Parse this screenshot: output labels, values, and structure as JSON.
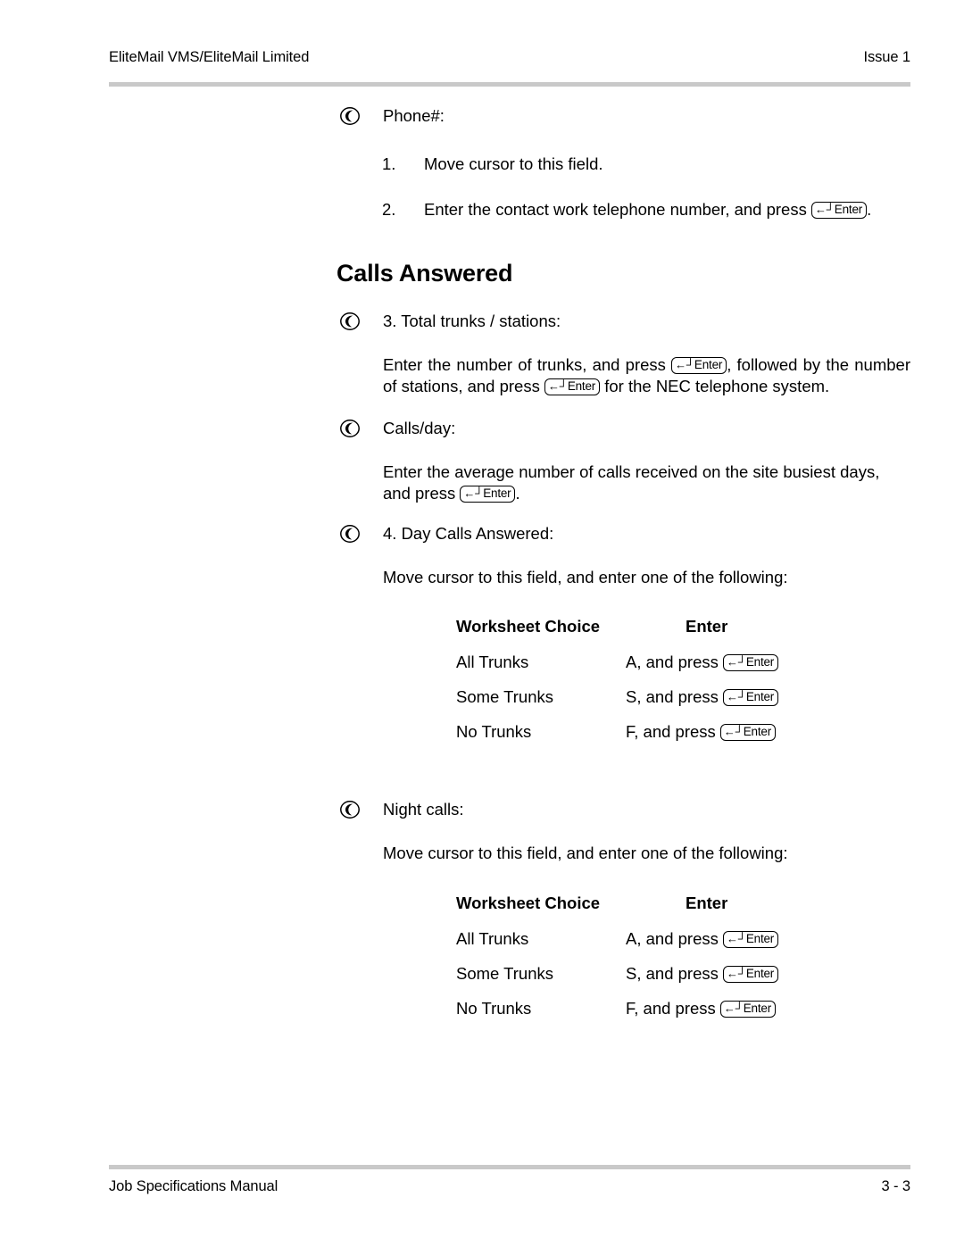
{
  "header": {
    "left": "EliteMail VMS/EliteMail Limited",
    "right": "Issue 1"
  },
  "footer": {
    "left": "Job Specifications Manual",
    "right": "3 - 3"
  },
  "keycap": {
    "arrow": "←┘",
    "label": "Enter",
    "name": "enter-key"
  },
  "bullet_icon": "telephone-bullet-icon",
  "section": {
    "phone": {
      "label": "Phone#:",
      "steps": [
        {
          "num": "1.",
          "text": "Move cursor to this field."
        },
        {
          "num": "2.",
          "text_before": "Enter the contact work telephone number, and press",
          "text_after": "."
        }
      ]
    },
    "heading": "Calls Answered",
    "total_trunks": {
      "label": "3. Total trunks / stations:",
      "body_part1": "Enter the number of trunks, and press",
      "body_part2": ", followed by the number of stations, and press",
      "body_part3": "for the NEC telephone system."
    },
    "calls_per_day": {
      "label": "Calls/day:",
      "body_part1": "Enter the average number of calls received on the site busiest days, and press",
      "body_part2": "."
    },
    "day_calls_answered": {
      "label": "4. Day Calls Answered:",
      "instruction": "Move cursor to this field, and enter one of the following:"
    },
    "night_calls": {
      "label": "Night calls:",
      "instruction": "Move cursor to this field, and enter one of the following:"
    }
  },
  "tables": [
    {
      "name": "day-calls-answered-choice-table",
      "headers": [
        "Worksheet Choice",
        "Enter"
      ],
      "rows": [
        {
          "choice": "All Trunks",
          "enter_prefix": "A, and press"
        },
        {
          "choice": "Some Trunks",
          "enter_prefix": "S, and press"
        },
        {
          "choice": "No Trunks",
          "enter_prefix": "F, and press"
        }
      ]
    },
    {
      "name": "night-calls-choice-table",
      "headers": [
        "Worksheet Choice",
        "Enter"
      ],
      "rows": [
        {
          "choice": "All Trunks",
          "enter_prefix": "A, and press"
        },
        {
          "choice": "Some Trunks",
          "enter_prefix": "S, and press"
        },
        {
          "choice": "No Trunks",
          "enter_prefix": "F, and press"
        }
      ]
    }
  ],
  "colors": {
    "rule": "#c9c9c9",
    "text": "#000000",
    "page_background": "#ffffff"
  }
}
